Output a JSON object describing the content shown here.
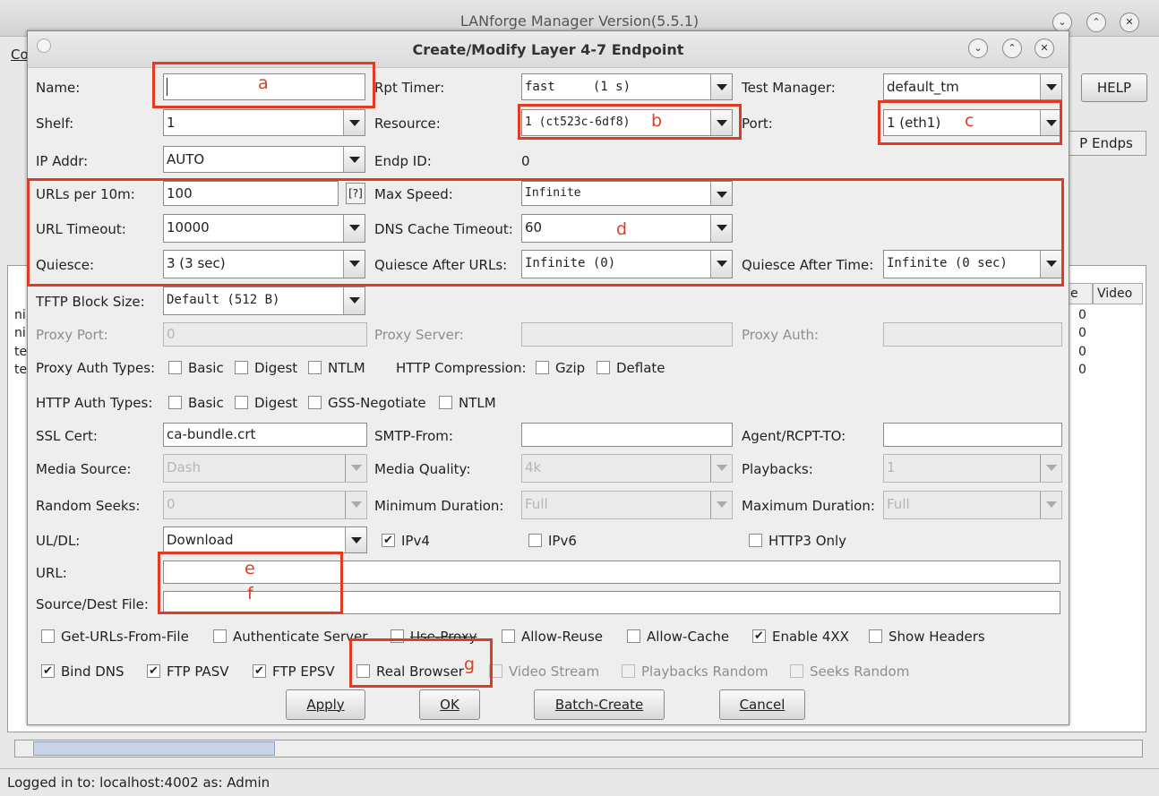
{
  "background": {
    "title": "LANforge Manager   Version(5.5.1)",
    "menu_fragment": "Co",
    "help_label": "HELP",
    "tab_fragment": "P Endps",
    "table_columns": [
      "e",
      "Video"
    ],
    "row_fragments": [
      "ni",
      "ni",
      "te",
      "te"
    ],
    "row_values": [
      "0",
      "0",
      "0",
      "0"
    ],
    "status": "Logged in to:  localhost:4002  as:  Admin"
  },
  "dialog": {
    "title": "Create/Modify Layer 4-7 Endpoint",
    "name_label": "Name:",
    "name_value": "",
    "rpt_timer_label": "Rpt Timer:",
    "rpt_timer_value": "fast     (1 s)",
    "test_manager_label": "Test Manager:",
    "test_manager_value": "default_tm",
    "shelf_label": "Shelf:",
    "shelf_value": "1",
    "resource_label": "Resource:",
    "resource_value": "1 (ct523c-6df8)",
    "port_label": "Port:",
    "port_value": "1 (eth1)",
    "ip_label": "IP Addr:",
    "ip_value": "AUTO",
    "endp_id_label": "Endp ID:",
    "endp_id_value": "0",
    "urls_label": "URLs per 10m:",
    "urls_value": "100",
    "urls_hint": "[?]",
    "max_speed_label": "Max Speed:",
    "max_speed_value": "Infinite",
    "url_timeout_label": "URL Timeout:",
    "url_timeout_value": "10000",
    "dns_label": "DNS Cache Timeout:",
    "dns_value": "60",
    "quiesce_label": "Quiesce:",
    "quiesce_value": "3 (3 sec)",
    "quiesce_urls_label": "Quiesce After URLs:",
    "quiesce_urls_value": "Infinite (0)",
    "quiesce_time_label": "Quiesce After Time:",
    "quiesce_time_value": "Infinite (0 sec)",
    "tftp_label": "TFTP Block Size:",
    "tftp_value": "Default (512 B)",
    "proxy_port_label": "Proxy Port:",
    "proxy_port_value": "0",
    "proxy_server_label": "Proxy Server:",
    "proxy_auth_label": "Proxy Auth:",
    "proxy_auth_types_label": "Proxy Auth Types:",
    "proxy_auth_types": [
      "Basic",
      "Digest",
      "NTLM"
    ],
    "http_comp_label": "HTTP Compression:",
    "http_comp_types": [
      "Gzip",
      "Deflate"
    ],
    "http_auth_label": "HTTP Auth Types:",
    "http_auth_types": [
      "Basic",
      "Digest",
      "GSS-Negotiate",
      "NTLM"
    ],
    "ssl_label": "SSL Cert:",
    "ssl_value": "ca-bundle.crt",
    "smtp_label": "SMTP-From:",
    "agent_label": "Agent/RCPT-TO:",
    "media_source_label": "Media Source:",
    "media_source_value": "Dash",
    "media_quality_label": "Media Quality:",
    "media_quality_value": "4k",
    "playbacks_label": "Playbacks:",
    "playbacks_value": "1",
    "random_seeks_label": "Random Seeks:",
    "random_seeks_value": "0",
    "min_dur_label": "Minimum Duration:",
    "min_dur_value": "Full",
    "max_dur_label": "Maximum Duration:",
    "max_dur_value": "Full",
    "uldl_label": "UL/DL:",
    "uldl_value": "Download",
    "ipv4_label": "IPv4",
    "ipv6_label": "IPv6",
    "http3_label": "HTTP3 Only",
    "url_label": "URL:",
    "src_label": "Source/Dest File:",
    "opt1": [
      "Get-URLs-From-File",
      "Authenticate Server",
      "Use-Proxy",
      "Allow-Reuse",
      "Allow-Cache",
      "Enable 4XX",
      "Show Headers"
    ],
    "opt2": [
      "Bind DNS",
      "FTP PASV",
      "FTP EPSV",
      "Real Browser",
      "Video Stream",
      "Playbacks Random",
      "Seeks Random"
    ],
    "buttons": {
      "apply": "Apply",
      "ok": "OK",
      "batch": "Batch-Create",
      "cancel": "Cancel"
    }
  },
  "annotations": {
    "a": "a",
    "b": "b",
    "c": "c",
    "d": "d",
    "e": "e",
    "f": "f",
    "g": "g"
  },
  "colors": {
    "annotation": "#e03c24",
    "dialog_bg": "#eeeeee"
  }
}
